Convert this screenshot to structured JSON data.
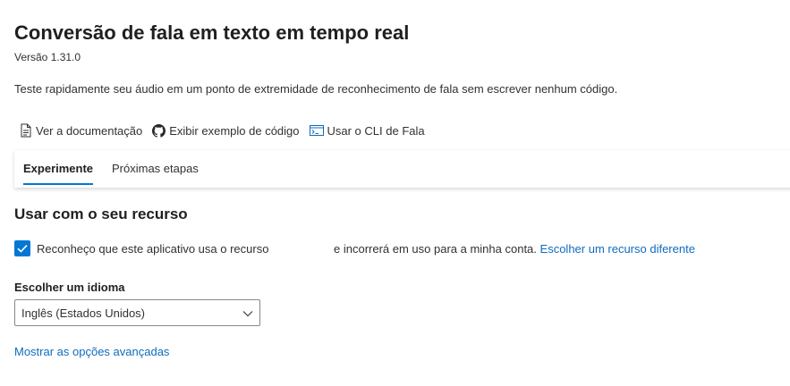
{
  "header": {
    "title": "Conversão de fala em texto em tempo real",
    "version": "Versão 1.31.0",
    "description": "Teste rapidamente seu áudio em um ponto de extremidade de reconhecimento de fala sem escrever nenhum código."
  },
  "links": [
    {
      "label": "Ver a documentação",
      "icon": "document-icon"
    },
    {
      "label": "Exibir exemplo de código",
      "icon": "github-icon"
    },
    {
      "label": "Usar o CLI de Fala",
      "icon": "cli-icon"
    }
  ],
  "tabs": [
    {
      "label": "Experimente",
      "active": true
    },
    {
      "label": "Próximas etapas",
      "active": false
    }
  ],
  "resource_section": {
    "heading": "Usar com o seu recurso",
    "checkbox_checked": true,
    "ack_text_before": "Reconheço que este aplicativo usa o recurso",
    "ack_text_after": "e incorrerá em uso para a minha conta.",
    "ack_link": "Escolher um recurso diferente"
  },
  "language": {
    "label": "Escolher um idioma",
    "selected": "Inglês (Estados Unidos)"
  },
  "advanced_link": "Mostrar as opções avançadas",
  "colors": {
    "accent": "#0078d4",
    "link": "#0f6cbd",
    "text": "#323130"
  }
}
